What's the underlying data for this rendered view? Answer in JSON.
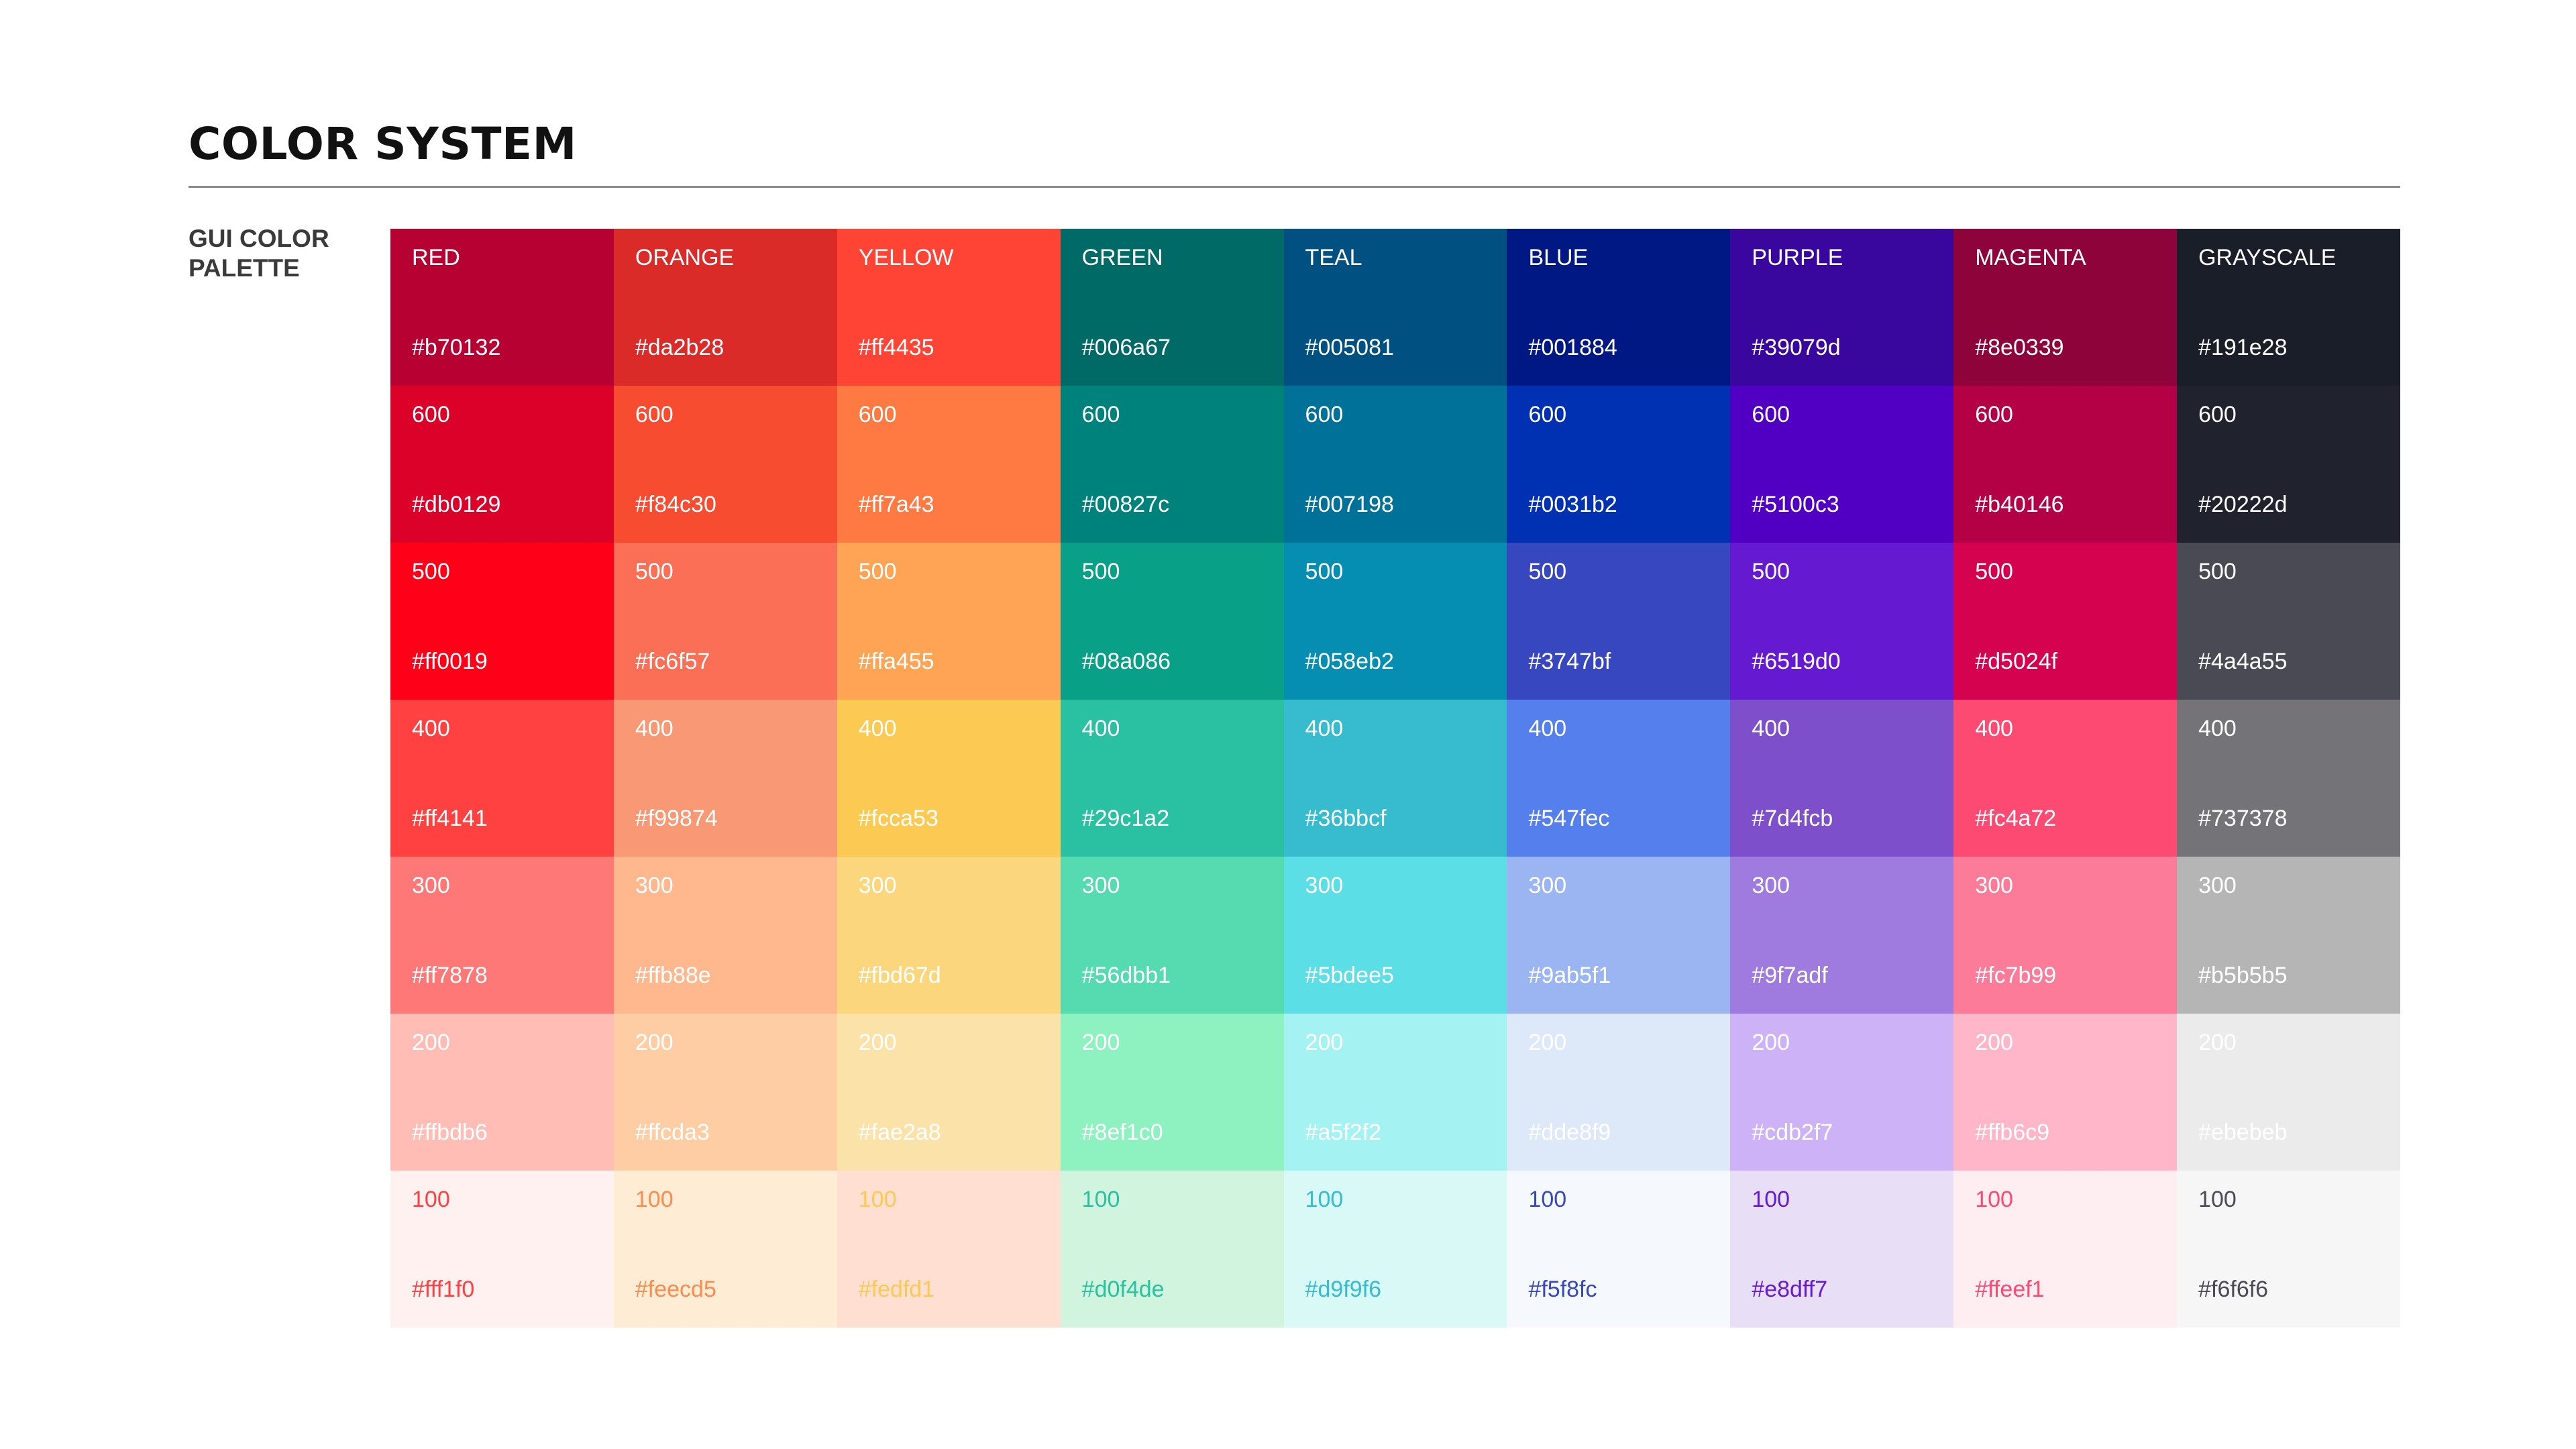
{
  "title": "COLOR SYSTEM",
  "section_label": "GUI COLOR PALETTE",
  "palette": [
    {
      "name": "RED",
      "shades": [
        {
          "label": "RED",
          "hex": "#b70132",
          "text_color": "#ffffff"
        },
        {
          "label": "600",
          "hex": "#db0129",
          "text_color": "#ffffff"
        },
        {
          "label": "500",
          "hex": "#ff0019",
          "text_color": "#ffffff"
        },
        {
          "label": "400",
          "hex": "#ff4141",
          "text_color": "#ffffff"
        },
        {
          "label": "300",
          "hex": "#ff7878",
          "text_color": "#ffffff"
        },
        {
          "label": "200",
          "hex": "#ffbdb6",
          "text_color": "#ffffff"
        },
        {
          "label": "100",
          "hex": "#fff1f0",
          "text_color": "#ff4141"
        }
      ]
    },
    {
      "name": "ORANGE",
      "shades": [
        {
          "label": "ORANGE",
          "hex": "#da2b28",
          "text_color": "#ffffff"
        },
        {
          "label": "600",
          "hex": "#f84c30",
          "text_color": "#ffffff"
        },
        {
          "label": "500",
          "hex": "#fc6f57",
          "text_color": "#ffffff"
        },
        {
          "label": "400",
          "hex": "#f99874",
          "text_color": "#ffffff"
        },
        {
          "label": "300",
          "hex": "#ffb88e",
          "text_color": "#ffffff"
        },
        {
          "label": "200",
          "hex": "#ffcda3",
          "text_color": "#ffffff"
        },
        {
          "label": "100",
          "hex": "#feecd5",
          "text_color": "#fc8c4e"
        }
      ]
    },
    {
      "name": "YELLOW",
      "shades": [
        {
          "label": "YELLOW",
          "hex": "#ff4435",
          "text_color": "#ffffff"
        },
        {
          "label": "600",
          "hex": "#ff7a43",
          "text_color": "#ffffff"
        },
        {
          "label": "500",
          "hex": "#ffa455",
          "text_color": "#ffffff"
        },
        {
          "label": "400",
          "hex": "#fcca53",
          "text_color": "#ffffff"
        },
        {
          "label": "300",
          "hex": "#fbd67d",
          "text_color": "#ffffff"
        },
        {
          "label": "200",
          "hex": "#fae2a8",
          "text_color": "#ffffff"
        },
        {
          "label": "100",
          "hex": "#fedfd1",
          "text_color": "#fcca53"
        }
      ]
    },
    {
      "name": "GREEN",
      "shades": [
        {
          "label": "GREEN",
          "hex": "#006a67",
          "text_color": "#ffffff"
        },
        {
          "label": "600",
          "hex": "#00827c",
          "text_color": "#ffffff"
        },
        {
          "label": "500",
          "hex": "#08a086",
          "text_color": "#ffffff"
        },
        {
          "label": "400",
          "hex": "#29c1a2",
          "text_color": "#ffffff"
        },
        {
          "label": "300",
          "hex": "#56dbb1",
          "text_color": "#ffffff"
        },
        {
          "label": "200",
          "hex": "#8ef1c0",
          "text_color": "#ffffff"
        },
        {
          "label": "100",
          "hex": "#d0f4de",
          "text_color": "#29c1a2"
        }
      ]
    },
    {
      "name": "TEAL",
      "shades": [
        {
          "label": "TEAL",
          "hex": "#005081",
          "text_color": "#ffffff"
        },
        {
          "label": "600",
          "hex": "#007198",
          "text_color": "#ffffff"
        },
        {
          "label": "500",
          "hex": "#058eb2",
          "text_color": "#ffffff"
        },
        {
          "label": "400",
          "hex": "#36bbcf",
          "text_color": "#ffffff"
        },
        {
          "label": "300",
          "hex": "#5bdee5",
          "text_color": "#ffffff"
        },
        {
          "label": "200",
          "hex": "#a5f2f2",
          "text_color": "#ffffff"
        },
        {
          "label": "100",
          "hex": "#d9f9f6",
          "text_color": "#36bbcf"
        }
      ]
    },
    {
      "name": "BLUE",
      "shades": [
        {
          "label": "BLUE",
          "hex": "#001884",
          "text_color": "#ffffff"
        },
        {
          "label": "600",
          "hex": "#0031b2",
          "text_color": "#ffffff"
        },
        {
          "label": "500",
          "hex": "#3747bf",
          "text_color": "#ffffff"
        },
        {
          "label": "400",
          "hex": "#547fec",
          "text_color": "#ffffff"
        },
        {
          "label": "300",
          "hex": "#9ab5f1",
          "text_color": "#ffffff"
        },
        {
          "label": "200",
          "hex": "#dde8f9",
          "text_color": "#ffffff"
        },
        {
          "label": "100",
          "hex": "#f5f8fc",
          "text_color": "#3747bf"
        }
      ]
    },
    {
      "name": "PURPLE",
      "shades": [
        {
          "label": "PURPLE",
          "hex": "#39079d",
          "text_color": "#ffffff"
        },
        {
          "label": "600",
          "hex": "#5100c3",
          "text_color": "#ffffff"
        },
        {
          "label": "500",
          "hex": "#6519d0",
          "text_color": "#ffffff"
        },
        {
          "label": "400",
          "hex": "#7d4fcb",
          "text_color": "#ffffff"
        },
        {
          "label": "300",
          "hex": "#9f7adf",
          "text_color": "#ffffff"
        },
        {
          "label": "200",
          "hex": "#cdb2f7",
          "text_color": "#ffffff"
        },
        {
          "label": "100",
          "hex": "#e8dff7",
          "text_color": "#6519d0"
        }
      ]
    },
    {
      "name": "MAGENTA",
      "shades": [
        {
          "label": "MAGENTA",
          "hex": "#8e0339",
          "text_color": "#ffffff"
        },
        {
          "label": "600",
          "hex": "#b40146",
          "text_color": "#ffffff"
        },
        {
          "label": "500",
          "hex": "#d5024f",
          "text_color": "#ffffff"
        },
        {
          "label": "400",
          "hex": "#fc4a72",
          "text_color": "#ffffff"
        },
        {
          "label": "300",
          "hex": "#fc7b99",
          "text_color": "#ffffff"
        },
        {
          "label": "200",
          "hex": "#ffb6c9",
          "text_color": "#ffffff"
        },
        {
          "label": "100",
          "hex": "#ffeef1",
          "text_color": "#fc4a72"
        }
      ]
    },
    {
      "name": "GRAYSCALE",
      "shades": [
        {
          "label": "GRAYSCALE",
          "hex": "#191e28",
          "text_color": "#ffffff"
        },
        {
          "label": "600",
          "hex": "#20222d",
          "text_color": "#ffffff"
        },
        {
          "label": "500",
          "hex": "#4a4a55",
          "text_color": "#ffffff"
        },
        {
          "label": "400",
          "hex": "#737378",
          "text_color": "#ffffff"
        },
        {
          "label": "300",
          "hex": "#b5b5b5",
          "text_color": "#ffffff"
        },
        {
          "label": "200",
          "hex": "#ebebeb",
          "text_color": "#ffffff"
        },
        {
          "label": "100",
          "hex": "#f6f6f6",
          "text_color": "#4a4a55"
        }
      ]
    }
  ]
}
